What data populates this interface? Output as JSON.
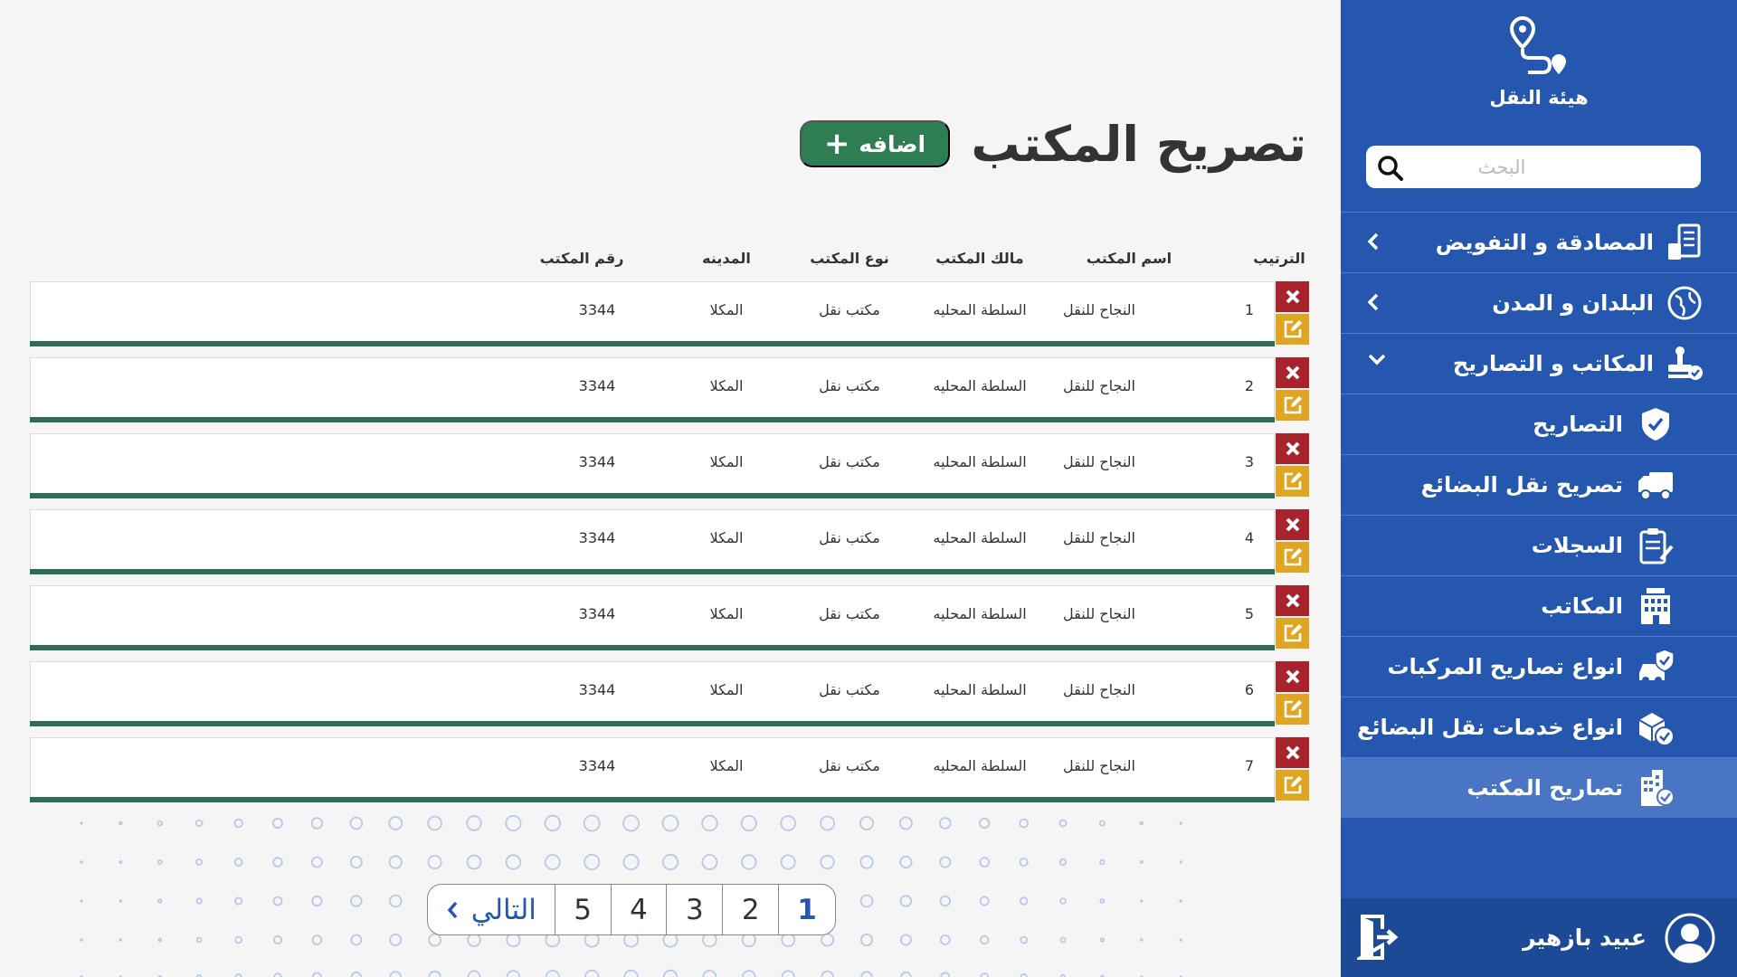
{
  "sidebar": {
    "logo_text": "هيئة النقل",
    "search_placeholder": "البحث",
    "menu": [
      {
        "label": "المصادقة و التفويض",
        "icon": "document-check-icon",
        "chevron": "chevron-left-icon"
      },
      {
        "label": "البلدان و المدن",
        "icon": "globe-icon",
        "chevron": "chevron-left-icon"
      },
      {
        "label": "المكاتب و التصاريح",
        "icon": "stamp-icon",
        "chevron": "chevron-down-icon"
      }
    ],
    "submenu": [
      {
        "label": "التصاريح",
        "icon": "shield-check-icon"
      },
      {
        "label": "تصريح نقل البضائع",
        "icon": "truck-icon"
      },
      {
        "label": "السجلات",
        "icon": "clipboard-icon"
      },
      {
        "label": "المكاتب",
        "icon": "office-building-icon"
      },
      {
        "label": "انواع تصاريح المركبات",
        "icon": "car-shield-icon"
      },
      {
        "label": "انواع خدمات نقل البضائع",
        "icon": "boxes-check-icon"
      },
      {
        "label": "تصاريح المكتب",
        "icon": "building-check-icon",
        "active": true
      }
    ],
    "user_name": "عبيد بازهير"
  },
  "main": {
    "title": "تصريح المكتب",
    "add_label": "اضافه",
    "columns": [
      "الترتيب",
      "اسم المكتب",
      "مالك المكتب",
      "نوع المكتب",
      "المدينه",
      "رقم المكتب"
    ],
    "rows": [
      [
        "1",
        "النجاح للنقل",
        "السلطة المحليه",
        "مكتب نقل",
        "المكلا",
        "3344"
      ],
      [
        "2",
        "النجاح للنقل",
        "السلطة المحليه",
        "مكتب نقل",
        "المكلا",
        "3344"
      ],
      [
        "3",
        "النجاح للنقل",
        "السلطة المحليه",
        "مكتب نقل",
        "المكلا",
        "3344"
      ],
      [
        "4",
        "النجاح للنقل",
        "السلطة المحليه",
        "مكتب نقل",
        "المكلا",
        "3344"
      ],
      [
        "5",
        "النجاح للنقل",
        "السلطة المحليه",
        "مكتب نقل",
        "المكلا",
        "3344"
      ],
      [
        "6",
        "النجاح للنقل",
        "السلطة المحليه",
        "مكتب نقل",
        "المكلا",
        "3344"
      ],
      [
        "7",
        "النجاح للنقل",
        "السلطة المحليه",
        "مكتب نقل",
        "المكلا",
        "3344"
      ]
    ],
    "pagination": {
      "pages": [
        "1",
        "2",
        "3",
        "4",
        "5"
      ],
      "current": "1",
      "next_label": "التالي"
    }
  },
  "colors": {
    "sidebar": "#2457ad",
    "active_item": "#4a75c4",
    "add_button": "#2f7d52",
    "row_underline": "#2f6e50",
    "delete": "#a8232b",
    "edit": "#e0a521"
  }
}
